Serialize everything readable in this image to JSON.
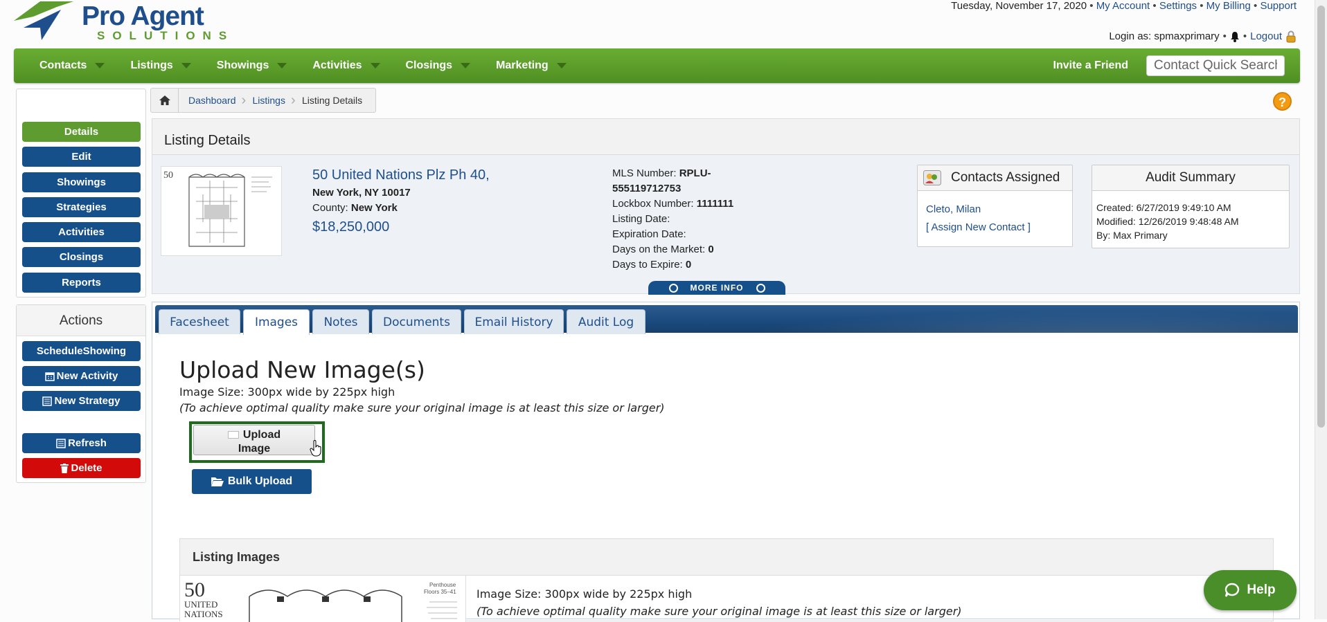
{
  "header": {
    "logo_name": "Pro Agent",
    "logo_tag": "SOLUTIONS",
    "date": "Tuesday, November 17, 2020",
    "top_links": [
      "My Account",
      "Settings",
      "My Billing",
      "Support"
    ],
    "login_label": "Login as: spmaxprimary",
    "logout": "Logout"
  },
  "nav": {
    "items": [
      "Contacts",
      "Listings",
      "Showings",
      "Activities",
      "Closings",
      "Marketing"
    ],
    "invite": "Invite a Friend",
    "search_placeholder": "Contact Quick Search"
  },
  "sidebar": {
    "nav_buttons": [
      "Details",
      "Edit",
      "Showings",
      "Strategies",
      "Activities",
      "Closings",
      "Reports"
    ],
    "actions_title": "Actions",
    "actions": {
      "schedule": "ScheduleShowing",
      "new_activity": "New Activity",
      "new_strategy": "New Strategy",
      "refresh": "Refresh",
      "delete": "Delete"
    }
  },
  "breadcrumb": [
    "Dashboard",
    "Listings",
    "Listing Details"
  ],
  "details": {
    "title": "Listing Details",
    "address1": "50 United Nations Plz Ph 40,",
    "address2": "New York, NY 10017",
    "county_label": "County:",
    "county": "New York",
    "price": "$18,250,000",
    "mls_label": "MLS Number:",
    "mls": "RPLU-",
    "mls2": "555119712753",
    "lockbox_label": "Lockbox Number:",
    "lockbox": "1111111",
    "listing_date_label": "Listing Date:",
    "expiration_label": "Expiration Date:",
    "dom_label": "Days on the Market:",
    "dom": "0",
    "dte_label": "Days to Expire:",
    "dte": "0",
    "more_info": "MORE INFO"
  },
  "contacts_card": {
    "title": "Contacts Assigned",
    "contact": "Cleto, Milan",
    "assign": "[ Assign New Contact ]"
  },
  "audit_card": {
    "title": "Audit Summary",
    "created": "Created: 6/27/2019 9:49:10 AM",
    "modified": "Modified: 12/26/2019 9:48:48 AM",
    "by": "By: Max Primary"
  },
  "tabs": [
    "Facesheet",
    "Images",
    "Notes",
    "Documents",
    "Email History",
    "Audit Log"
  ],
  "active_tab": "Images",
  "upload": {
    "title": "Upload New Image(s)",
    "size": "Image Size: 300px wide by 225px high",
    "quality": "(To achieve optimal quality make sure your original image is at least this size or larger)",
    "upload_label": "Upload",
    "upload_label2": "Image",
    "bulk_label": "Bulk Upload"
  },
  "listing_images": {
    "title": "Listing Images",
    "thumb_big": "50",
    "thumb_lines": [
      "UNITED",
      "NATIONS"
    ],
    "thumb_side": [
      "Penthouse",
      "Floors 35–41"
    ],
    "size": "Image Size: 300px wide by 225px high",
    "quality": "(To achieve optimal quality make sure your original image is at least this size or larger)"
  },
  "help": "Help",
  "colors": {
    "green": "#5e9c2f",
    "blue": "#16508a",
    "red": "#d20a0a"
  }
}
